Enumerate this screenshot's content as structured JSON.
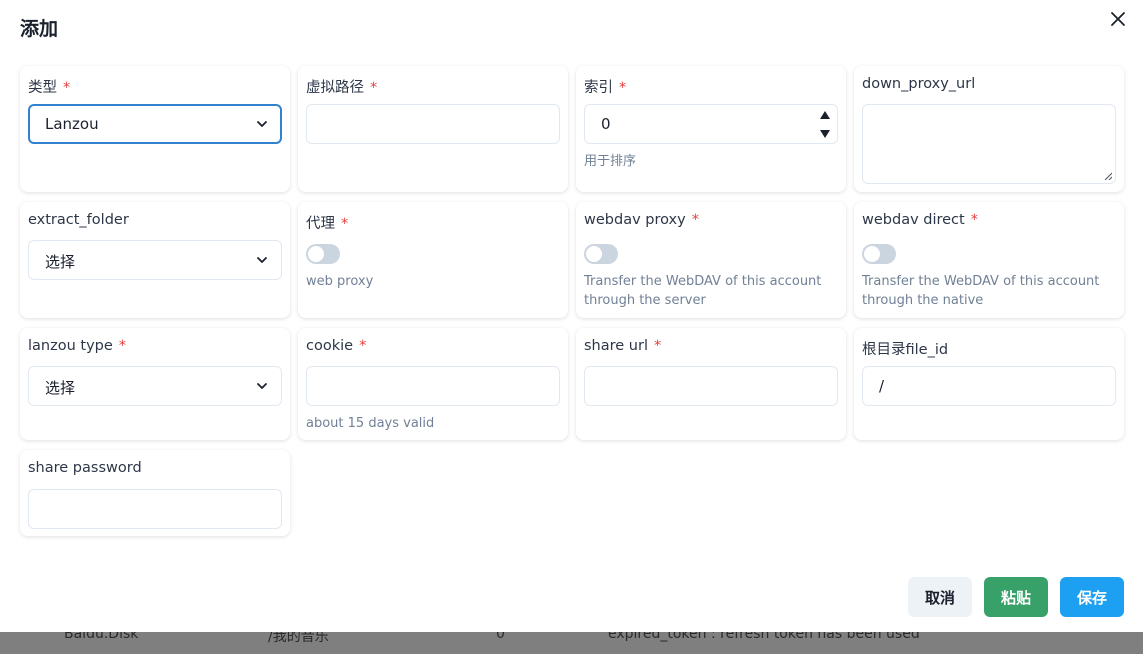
{
  "modal": {
    "title": "添加",
    "close_icon": "close-icon"
  },
  "fields": {
    "type": {
      "label": "类型",
      "required": "*",
      "value": "Lanzou"
    },
    "mount_path": {
      "label": "虚拟路径",
      "required": "*",
      "value": ""
    },
    "order": {
      "label": "索引",
      "required": "*",
      "value": "0",
      "helper": "用于排序"
    },
    "down_proxy_url": {
      "label": "down_proxy_url",
      "value": ""
    },
    "extract_folder": {
      "label": "extract_folder",
      "value": "选择"
    },
    "proxy": {
      "label": "代理",
      "required": "*",
      "helper": "web proxy",
      "checked": false
    },
    "webdav_proxy": {
      "label": "webdav proxy",
      "required": "*",
      "helper": "Transfer the WebDAV of this account through the server",
      "checked": false
    },
    "webdav_direct": {
      "label": "webdav direct",
      "required": "*",
      "helper": "Transfer the WebDAV of this account through the native",
      "checked": false
    },
    "lanzou_type": {
      "label": "lanzou type",
      "required": "*",
      "value": "选择"
    },
    "cookie": {
      "label": "cookie",
      "required": "*",
      "value": "",
      "helper": "about 15 days valid"
    },
    "share_url": {
      "label": "share url",
      "required": "*",
      "value": ""
    },
    "root_folder_id": {
      "label": "根目录file_id",
      "value": "/"
    },
    "share_password": {
      "label": "share password",
      "value": ""
    }
  },
  "buttons": {
    "cancel": "取消",
    "paste": "粘贴",
    "save": "保存"
  },
  "background_row": {
    "driver": "Baidu.Disk",
    "path": "/我的音乐",
    "order": "0",
    "status": "expired_token : refresh token has been used"
  },
  "colors": {
    "primary": "#3182ce",
    "save": "#1ea0f2",
    "paste": "#38a169",
    "required": "#e53e3e"
  }
}
